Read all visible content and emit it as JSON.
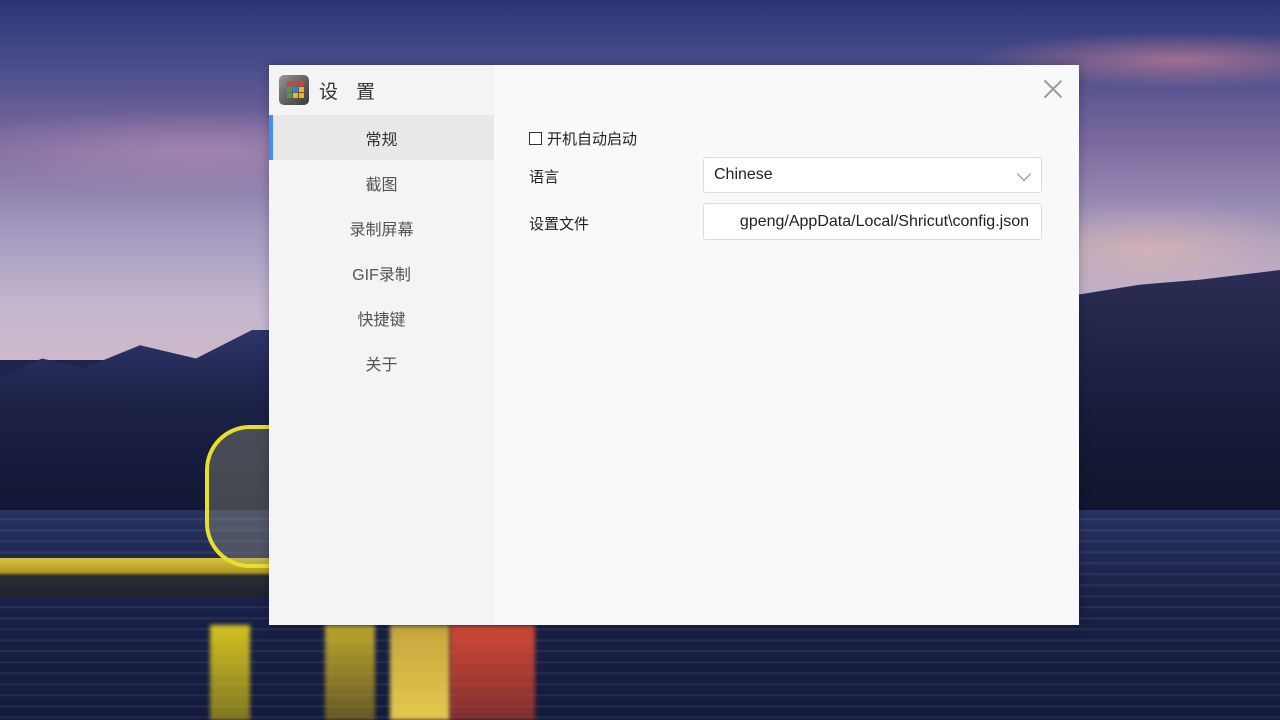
{
  "window": {
    "title": "设 置",
    "icon": "app-grid-icon",
    "close_icon": "close-icon"
  },
  "sidebar": {
    "active_index": 0,
    "accent_color": "#3d8ff5",
    "items": [
      {
        "label": "常规",
        "active": true
      },
      {
        "label": "截图",
        "active": false
      },
      {
        "label": "录制屏幕",
        "active": false
      },
      {
        "label": "GIF录制",
        "active": false
      },
      {
        "label": "快捷键",
        "active": false
      },
      {
        "label": "关于",
        "active": false
      }
    ]
  },
  "general": {
    "autostart": {
      "label": "开机自动启动",
      "checked": false
    },
    "language": {
      "label": "语言",
      "value": "Chinese"
    },
    "config_file": {
      "label": "设置文件",
      "value": "gpeng/AppData/Local/Shricut\\config.json"
    }
  },
  "app_icon_colors": [
    "#e53935",
    "#e53935",
    "#e53935",
    "#43a047",
    "#1e88e5",
    "#ffb300",
    "#43a047",
    "#ffb300",
    "#ffb300"
  ]
}
